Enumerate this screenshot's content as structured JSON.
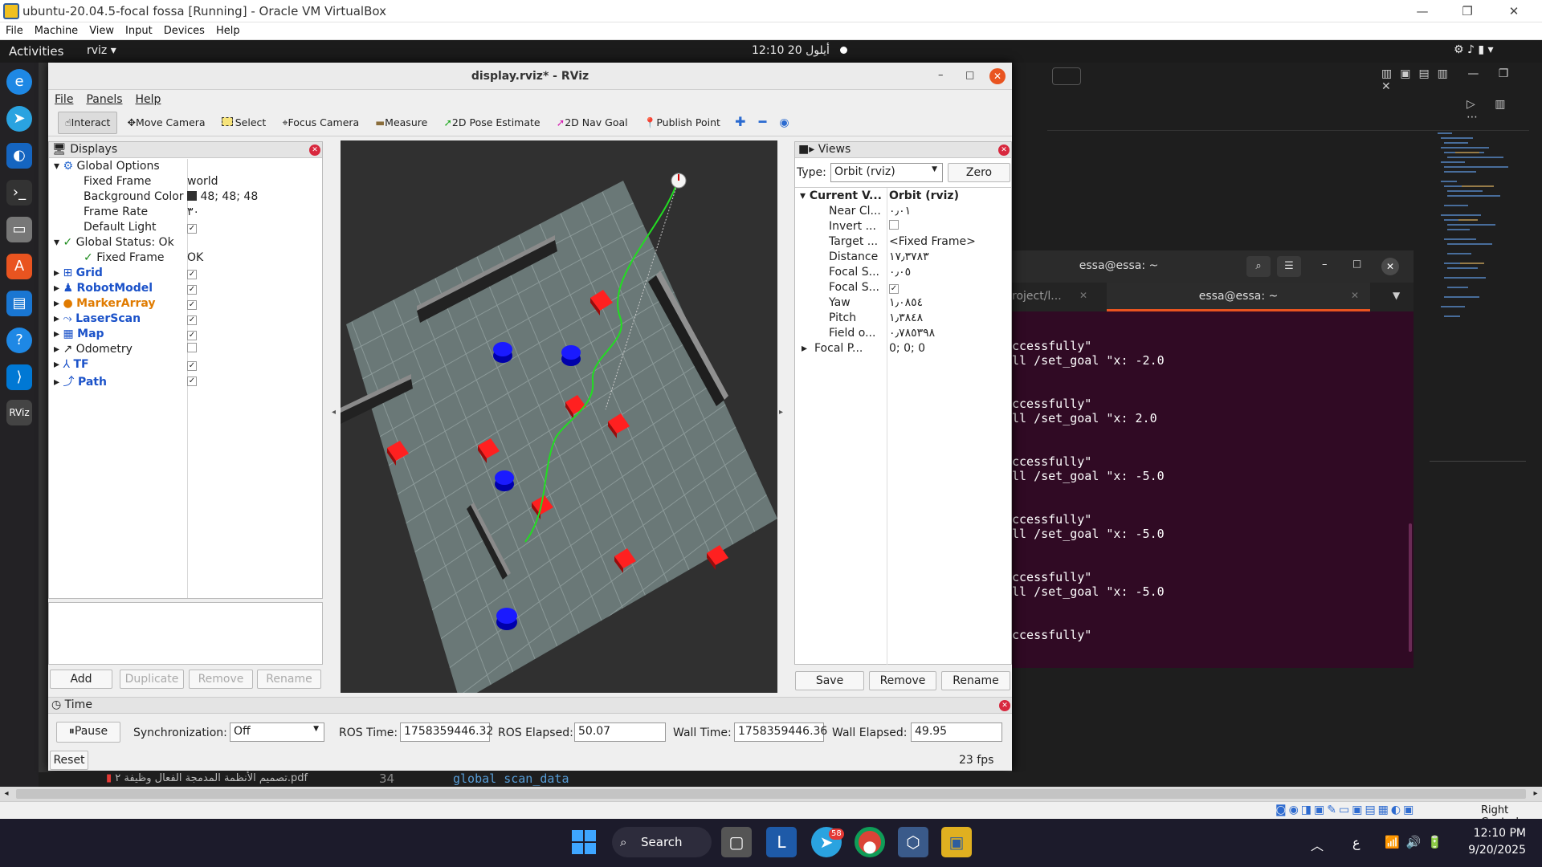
{
  "host_window": {
    "title": "ubuntu-20.04.5-focal fossa [Running] - Oracle VM VirtualBox",
    "menu": [
      "File",
      "Machine",
      "View",
      "Input",
      "Devices",
      "Help"
    ]
  },
  "guest_topbar": {
    "activities": "Activities",
    "app_name": "rviz",
    "clock": "12:10  20 أيلول"
  },
  "rviz": {
    "title": "display.rviz* - RViz",
    "menu": [
      "File",
      "Panels",
      "Help"
    ],
    "toolbar": {
      "interact": "Interact",
      "move_camera": "Move Camera",
      "select": "Select",
      "focus_camera": "Focus Camera",
      "measure": "Measure",
      "pose_estimate": "2D Pose Estimate",
      "nav_goal": "2D Nav Goal",
      "publish_point": "Publish Point"
    },
    "displays": {
      "title": "Displays",
      "global_options": "Global Options",
      "fixed_frame_label": "Fixed Frame",
      "fixed_frame_value": "world",
      "bg_color_label": "Background Color",
      "bg_color_value": "48; 48; 48",
      "frame_rate_label": "Frame Rate",
      "frame_rate_value": "٣٠",
      "default_light_label": "Default Light",
      "global_status": "Global Status: Ok",
      "status_fixed_frame": "Fixed Frame",
      "status_fixed_frame_value": "OK",
      "items": [
        {
          "label": "Grid",
          "checked": true,
          "color": "#1b52c9"
        },
        {
          "label": "RobotModel",
          "checked": true,
          "color": "#1b52c9"
        },
        {
          "label": "MarkerArray",
          "checked": true,
          "color": "#e07b00"
        },
        {
          "label": "LaserScan",
          "checked": true,
          "color": "#1b52c9"
        },
        {
          "label": "Map",
          "checked": true,
          "color": "#1b52c9"
        },
        {
          "label": "Odometry",
          "checked": false,
          "color": "#222222"
        },
        {
          "label": "TF",
          "checked": true,
          "color": "#1b52c9"
        },
        {
          "label": "Path",
          "checked": true,
          "color": "#1b52c9"
        }
      ],
      "buttons": {
        "add": "Add",
        "duplicate": "Duplicate",
        "remove": "Remove",
        "rename": "Rename"
      }
    },
    "views": {
      "title": "Views",
      "type_label": "Type:",
      "type_value": "Orbit (rviz)",
      "zero": "Zero",
      "current_view": "Current V...",
      "current_view_value": "Orbit (rviz)",
      "props": [
        {
          "name": "Near Cl...",
          "value": "٠٫٠١"
        },
        {
          "name": "Invert ...",
          "value": ""
        },
        {
          "name": "Target ...",
          "value": "<Fixed Frame>"
        },
        {
          "name": "Distance",
          "value": "١٧٫٣٧٨٣"
        },
        {
          "name": "Focal S...",
          "value": "٠٫٠٥"
        },
        {
          "name": "Focal S...",
          "value": ""
        },
        {
          "name": "Yaw",
          "value": "١٫٠٨٥٤"
        },
        {
          "name": "Pitch",
          "value": "١٫٣٨٤٨"
        },
        {
          "name": "Field o...",
          "value": "٠٫٧٨٥٣٩٨"
        },
        {
          "name": "Focal P...",
          "value": "0; 0; 0"
        }
      ],
      "buttons": {
        "save": "Save",
        "remove": "Remove",
        "rename": "Rename"
      }
    },
    "time": {
      "title": "Time",
      "pause": "Pause",
      "sync_label": "Synchronization:",
      "sync_value": "Off",
      "ros_time_label": "ROS Time:",
      "ros_time": "1758359446.32",
      "ros_elapsed_label": "ROS Elapsed:",
      "ros_elapsed": "50.07",
      "wall_time_label": "Wall Time:",
      "wall_time": "1758359446.36",
      "wall_elapsed_label": "Wall Elapsed:",
      "wall_elapsed": "49.95",
      "reset": "Reset",
      "fps": "23 fps"
    }
  },
  "terminal": {
    "title": "essa@essa: ~",
    "tab_left": "roject/l...",
    "tab_active": "essa@essa: ~",
    "lines": [
      "ccessfully\"",
      "ll /set_goal \"x: -2.0",
      "",
      "",
      "ccessfully\"",
      "ll /set_goal \"x: 2.0",
      "",
      "",
      "ccessfully\"",
      "ll /set_goal \"x: -5.0",
      "",
      "",
      "ccessfully\"",
      "ll /set_goal \"x: -5.0",
      "",
      "",
      "ccessfully\"",
      "ll /set_goal \"x: -5.0",
      "",
      "",
      "ccessfully\""
    ]
  },
  "vscode_bottom": {
    "pdf_name": "تصميم الأنظمة المدمجة الفعال وظيفة ٢.pdf",
    "line_no": "34",
    "code": "global scan_data"
  },
  "vb_status": {
    "host_key": "Right Control"
  },
  "taskbar": {
    "search": "Search",
    "telegram_badge": "58",
    "lang": "ع",
    "time": "12:10 PM",
    "date": "9/20/2025"
  }
}
